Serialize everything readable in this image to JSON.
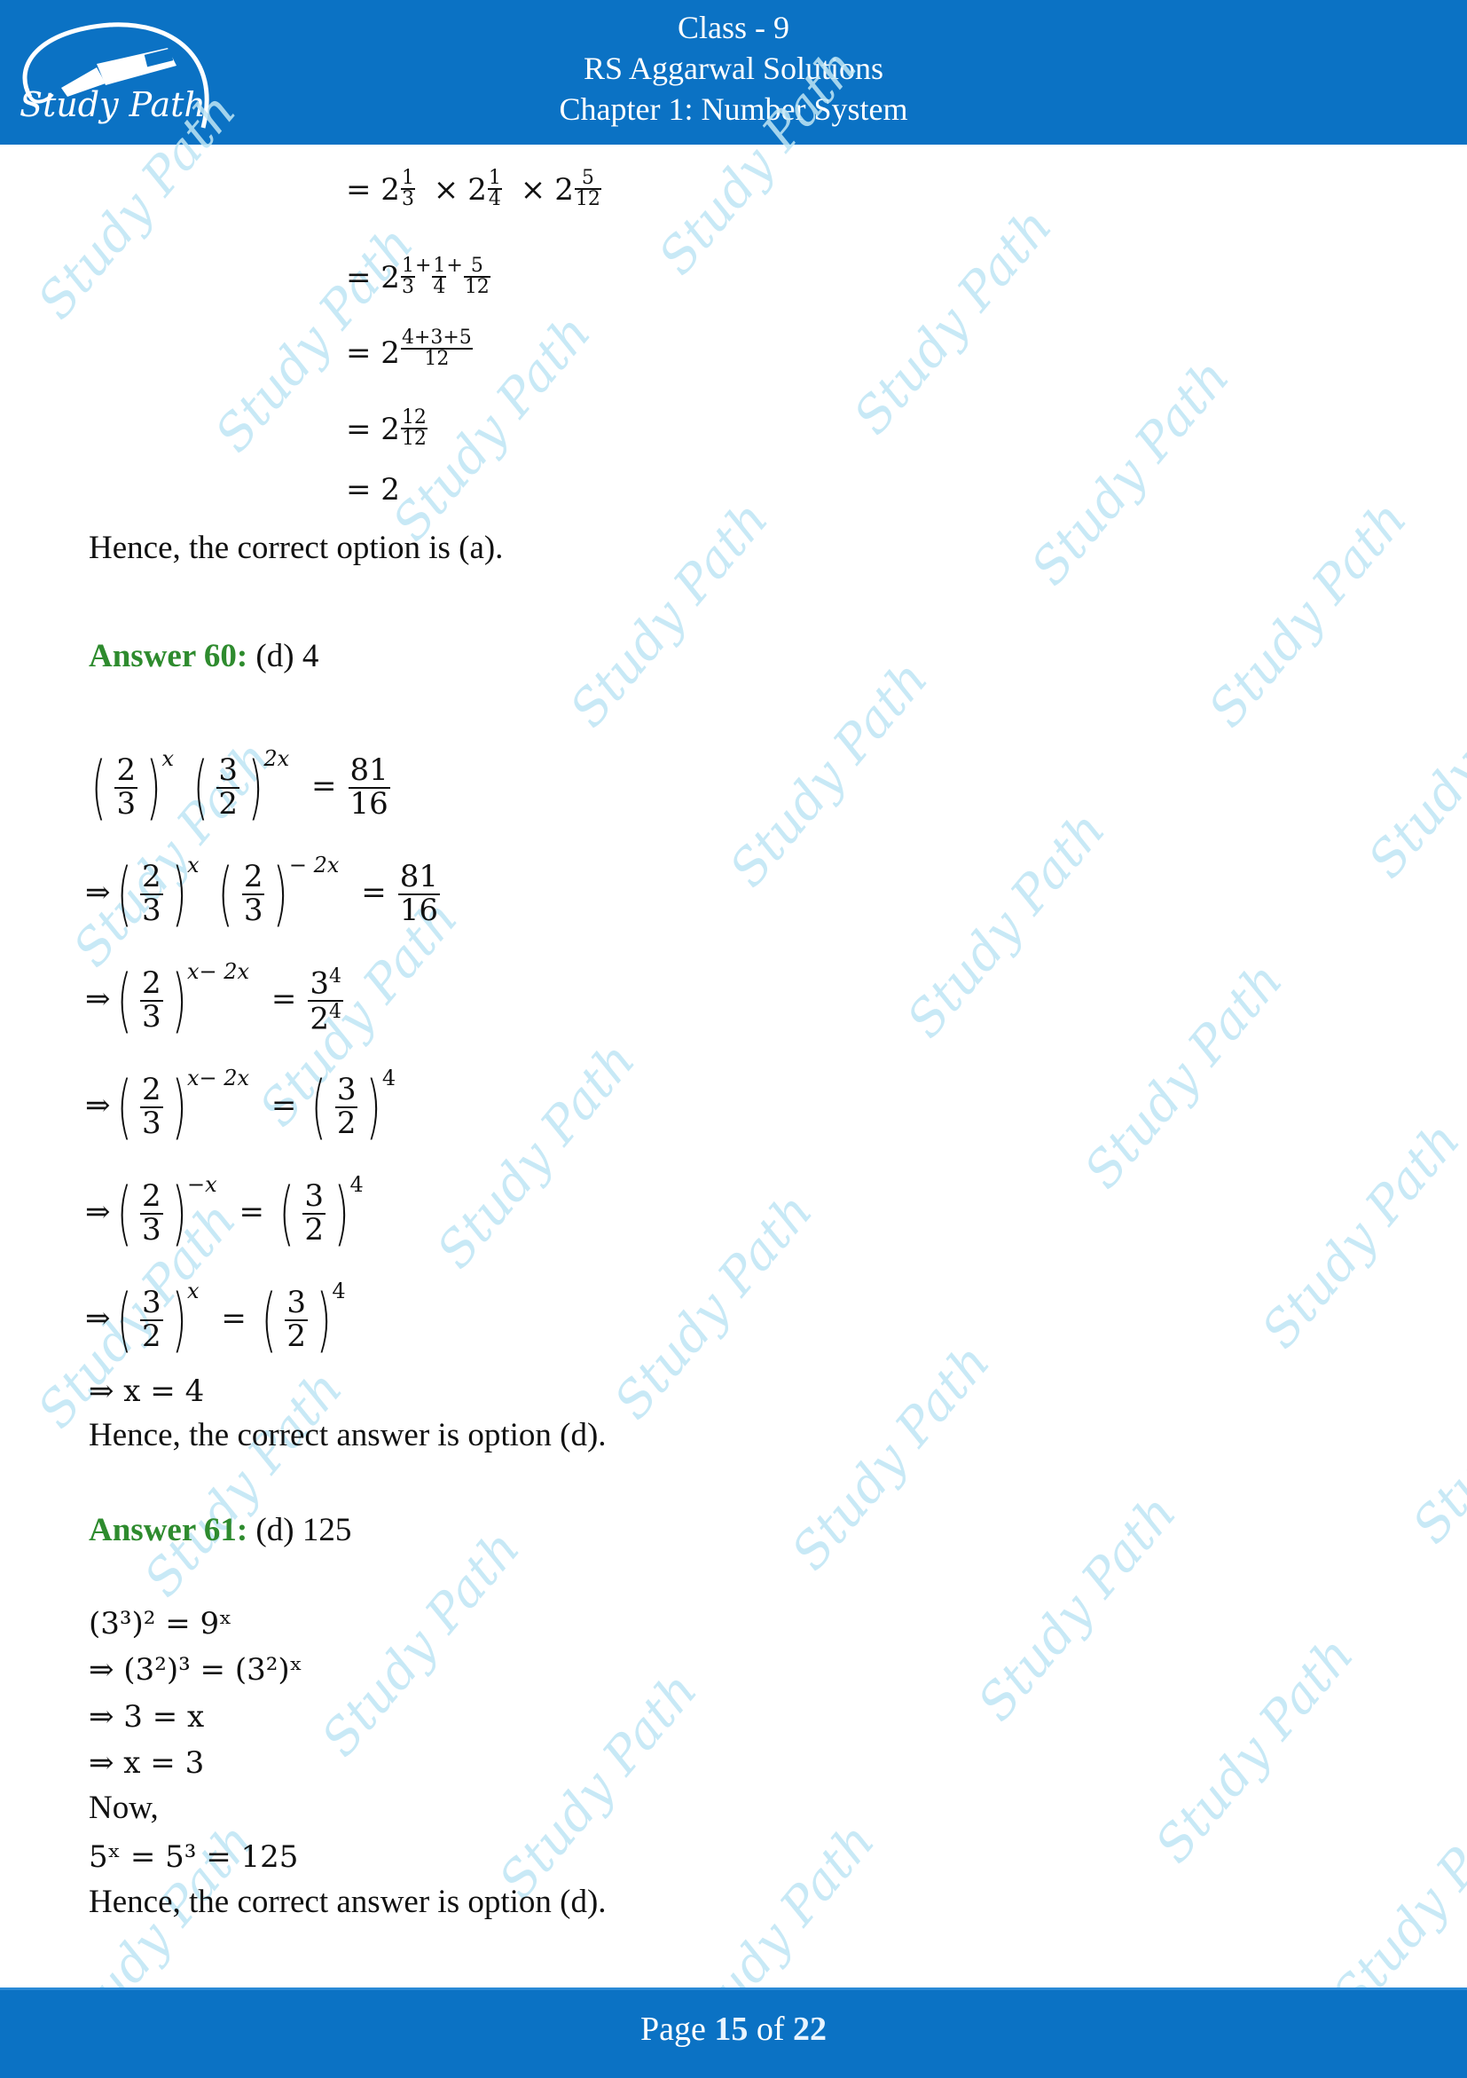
{
  "header": {
    "logo_text": "Study Path",
    "lines": [
      "Class - 9",
      "RS Aggarwal Solutions",
      "Chapter 1: Number System"
    ],
    "background_color": "#0B72C4"
  },
  "watermark_text": "Study Path",
  "colors": {
    "answer_label": "#2E8B2E",
    "watermark": "#BFE6F5",
    "text": "#111111"
  },
  "prev_solution": {
    "steps": [
      {
        "base": "2",
        "terms": [
          {
            "n": "1",
            "d": "3"
          },
          {
            "n": "1",
            "d": "4"
          },
          {
            "n": "5",
            "d": "12"
          }
        ],
        "form": "product"
      },
      {
        "base": "2",
        "terms": [
          {
            "n": "1",
            "d": "3"
          },
          {
            "n": "1",
            "d": "4"
          },
          {
            "n": "5",
            "d": "12"
          }
        ],
        "form": "sum-exponent"
      },
      {
        "base": "2",
        "exp_num": "4+3+5",
        "exp_den": "12"
      },
      {
        "base": "2",
        "exp_num": "12",
        "exp_den": "12"
      },
      {
        "result": "= 2"
      }
    ],
    "conclusion": "Hence, the correct option is (a)."
  },
  "answer60": {
    "label": "Answer 60:",
    "value": "(d) 4",
    "steps": {
      "s1": {
        "f1n": "2",
        "f1d": "3",
        "e1": "x",
        "f2n": "3",
        "f2d": "2",
        "e2": "2x",
        "rn": "81",
        "rd": "16"
      },
      "s2": {
        "f1n": "2",
        "f1d": "3",
        "e1": "x",
        "f2n": "2",
        "f2d": "3",
        "e2": "− 2x",
        "rn": "81",
        "rd": "16"
      },
      "s3": {
        "f1n": "2",
        "f1d": "3",
        "e1": "x− 2x",
        "rn": "3",
        "rne": "4",
        "rd": "2",
        "rde": "4"
      },
      "s4": {
        "f1n": "2",
        "f1d": "3",
        "e1": "x− 2x",
        "f2n": "3",
        "f2d": "2",
        "e2": "4"
      },
      "s5": {
        "f1n": "2",
        "f1d": "3",
        "e1": "−x",
        "f2n": "3",
        "f2d": "2",
        "e2": "4"
      },
      "s6": {
        "f1n": "3",
        "f1d": "2",
        "e1": "x",
        "f2n": "3",
        "f2d": "2",
        "e2": "4"
      },
      "s7": "⇒ x = 4"
    },
    "conclusion": "Hence, the correct answer is option (d)."
  },
  "answer61": {
    "label": "Answer 61:",
    "value": "(d) 125",
    "steps": [
      "(3³)² = 9ˣ",
      "⇒ (3²)³ = (3²)ˣ",
      "⇒ 3 = x",
      "⇒ x = 3",
      "Now,",
      "5ˣ = 5³ = 125"
    ],
    "conclusion": "Hence, the correct answer is option (d)."
  },
  "footer": {
    "prefix": "Page",
    "current": "15",
    "middle": "of",
    "total": "22"
  }
}
